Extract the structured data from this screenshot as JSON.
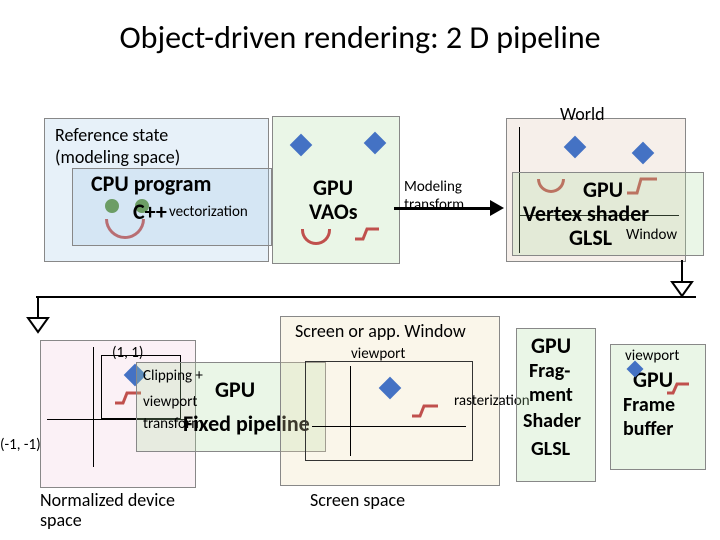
{
  "title": "Object-driven rendering: 2 D pipeline",
  "panels": {
    "ref": {
      "label_line1": "Reference state",
      "label_line2": "(modeling space)"
    },
    "cpu": {
      "heading": "CPU program",
      "sub": "C++",
      "annot": "vectorization"
    },
    "vao": {
      "heading": "GPU",
      "sub": "VAOs"
    },
    "world": {
      "label": "World"
    },
    "model_arrow": {
      "line1": "Modeling",
      "line2": "transform"
    },
    "vertex": {
      "heading": "GPU",
      "sub": "Vertex shader",
      "lang": "GLSL"
    },
    "window": {
      "label": "Window"
    },
    "ndc": {
      "label": "Normalized device",
      "label2": "space",
      "coord_tr": "(1, 1)",
      "coord_bl": "(-1, -1)"
    },
    "fixed": {
      "heading": "GPU",
      "sub": "Fixed pipeline",
      "line1": "Clipping +",
      "line2": "viewport",
      "line3": "transform"
    },
    "screen_big": {
      "label": "Screen or app. Window"
    },
    "screen_small": {
      "label": "Screen space"
    },
    "viewport_label": "viewport",
    "raster_label": "rasterization",
    "frag": {
      "heading": "GPU",
      "line1": "Frag-",
      "line2": "ment",
      "line3": "Shader",
      "lang": "GLSL"
    },
    "fb": {
      "heading": "GPU",
      "sub1": "Frame",
      "sub2": "buffer",
      "viewport": "viewport"
    }
  },
  "chart_data": {
    "type": "diagram",
    "title": "Object-driven rendering: 2D pipeline",
    "nodes": [
      {
        "id": "ref",
        "label": "Reference state (modeling space)",
        "kind": "space"
      },
      {
        "id": "cpu",
        "label": "CPU program C++ (vectorization)",
        "kind": "stage"
      },
      {
        "id": "vao",
        "label": "GPU VAOs",
        "kind": "stage"
      },
      {
        "id": "world",
        "label": "World",
        "kind": "space"
      },
      {
        "id": "vertex",
        "label": "GPU Vertex shader GLSL",
        "kind": "stage"
      },
      {
        "id": "window",
        "label": "Window",
        "kind": "space"
      },
      {
        "id": "ndc",
        "label": "Normalized device space",
        "kind": "space",
        "extent": [
          [
            -1,
            -1
          ],
          [
            1,
            1
          ]
        ]
      },
      {
        "id": "fixed",
        "label": "GPU Fixed pipeline (Clipping + viewport transform)",
        "kind": "stage"
      },
      {
        "id": "screen",
        "label": "Screen or app. Window / Screen space",
        "kind": "space"
      },
      {
        "id": "frag",
        "label": "GPU Fragment Shader GLSL (rasterization)",
        "kind": "stage"
      },
      {
        "id": "fb",
        "label": "GPU Frame buffer (viewport)",
        "kind": "stage"
      }
    ],
    "edges": [
      {
        "from": "ref",
        "to": "cpu",
        "label": "vectorization"
      },
      {
        "from": "cpu",
        "to": "vao"
      },
      {
        "from": "vao",
        "to": "world",
        "label": "Modeling transform"
      },
      {
        "from": "world",
        "to": "vertex"
      },
      {
        "from": "vertex",
        "to": "window"
      },
      {
        "from": "window",
        "to": "ndc"
      },
      {
        "from": "ndc",
        "to": "fixed",
        "label": "Clipping + viewport transform"
      },
      {
        "from": "fixed",
        "to": "screen",
        "label": "viewport"
      },
      {
        "from": "screen",
        "to": "frag",
        "label": "rasterization"
      },
      {
        "from": "frag",
        "to": "fb",
        "label": "viewport"
      }
    ]
  }
}
